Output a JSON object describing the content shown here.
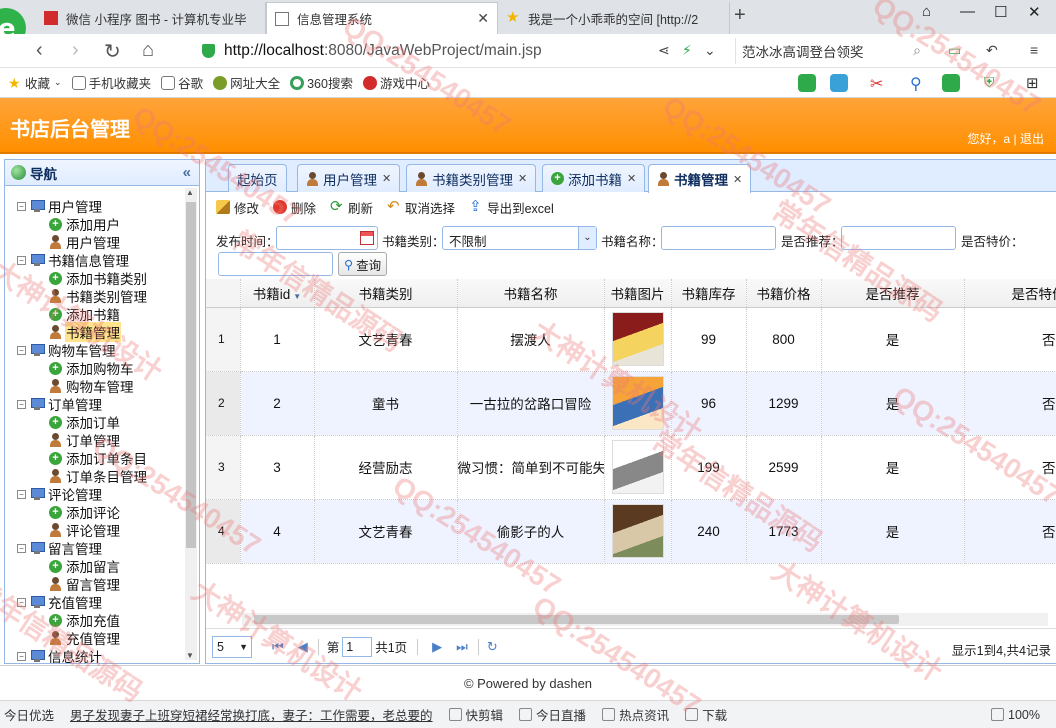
{
  "browser": {
    "tabs": [
      {
        "title": "微信 小程序 图书 - 计算机专业毕"
      },
      {
        "title": "信息管理系统"
      },
      {
        "title": "我是一个小乖乖的空间 [http://2"
      }
    ],
    "url_host": "http://localhost",
    "url_rest": ":8080/JavaWebProject/main.jsp",
    "search_text": "范冰冰高调登台领奖",
    "bookmarks": [
      "收藏",
      "手机收藏夹",
      "谷歌",
      "网址大全",
      "360搜索",
      "游戏中心"
    ]
  },
  "app": {
    "title": "书店后台管理",
    "greeting": "您好，a",
    "separator": "|",
    "logout": "退出"
  },
  "sidebar": {
    "title": "导航",
    "collapse_glyph": "«",
    "groups": [
      {
        "label": "用户管理",
        "items": [
          "添加用户",
          "用户管理"
        ]
      },
      {
        "label": "书籍信息管理",
        "items": [
          "添加书籍类别",
          "书籍类别管理",
          "添加书籍",
          "书籍管理"
        ]
      },
      {
        "label": "购物车管理",
        "items": [
          "添加购物车",
          "购物车管理"
        ]
      },
      {
        "label": "订单管理",
        "items": [
          "添加订单",
          "订单管理",
          "添加订单条目",
          "订单条目管理"
        ]
      },
      {
        "label": "评论管理",
        "items": [
          "添加评论",
          "评论管理"
        ]
      },
      {
        "label": "留言管理",
        "items": [
          "添加留言",
          "留言管理"
        ]
      },
      {
        "label": "充值管理",
        "items": [
          "添加充值",
          "充值管理"
        ]
      },
      {
        "label": "信息统计",
        "items": []
      }
    ]
  },
  "tabs": [
    {
      "label": "起始页",
      "icon": "none"
    },
    {
      "label": "用户管理",
      "icon": "person-icon"
    },
    {
      "label": "书籍类别管理",
      "icon": "person-icon"
    },
    {
      "label": "添加书籍",
      "icon": "add-icon"
    },
    {
      "label": "书籍管理",
      "icon": "person-icon"
    }
  ],
  "toolbar": {
    "edit": "修改",
    "delete": "删除",
    "refresh": "刷新",
    "cancel_select": "取消选择",
    "export": "导出到excel"
  },
  "filter": {
    "publish_time_label": "发布时间：",
    "category_label": "书籍类别：",
    "category_value": "不限制",
    "name_label": "书籍名称：",
    "recommend_label": "是否推荐：",
    "special_label": "是否特价：",
    "query_label": "查询"
  },
  "grid": {
    "columns": [
      "书籍id",
      "书籍类别",
      "书籍名称",
      "书籍图片",
      "书籍库存",
      "书籍价格",
      "是否推荐",
      "是否特价"
    ],
    "rows": [
      {
        "rn": "1",
        "id": "1",
        "category": "文艺青春",
        "name": "摆渡人",
        "stock": "99",
        "price": "800",
        "recommend": "是",
        "special": "否"
      },
      {
        "rn": "2",
        "id": "2",
        "category": "童书",
        "name": "一古拉的岔路口冒险",
        "stock": "96",
        "price": "1299",
        "recommend": "是",
        "special": "否"
      },
      {
        "rn": "3",
        "id": "3",
        "category": "经营励志",
        "name": "微习惯：简单到不可能失",
        "stock": "199",
        "price": "2599",
        "recommend": "是",
        "special": "否"
      },
      {
        "rn": "4",
        "id": "4",
        "category": "文艺青春",
        "name": "偷影子的人",
        "stock": "240",
        "price": "1773",
        "recommend": "是",
        "special": "否"
      }
    ]
  },
  "pager": {
    "page_size": "5",
    "page_prefix": "第",
    "page_value": "1",
    "page_total": "共1页",
    "info": "显示1到4,共4记录"
  },
  "footer": {
    "text": "© Powered by dashen"
  },
  "statusbar": {
    "items": [
      "今日优选",
      "男子发现妻子上班穿短裙经常换打底，妻子：工作需要，老总要的",
      "快剪辑",
      "今日直播",
      "热点资讯",
      "下载",
      "100%"
    ]
  },
  "watermark": [
    "QQ:254540457",
    "大神计算机设计",
    "常年信精品源码"
  ],
  "colors": {
    "header": "#ff9800",
    "panel_border": "#95b8e7",
    "selected": "#ffe48d"
  }
}
